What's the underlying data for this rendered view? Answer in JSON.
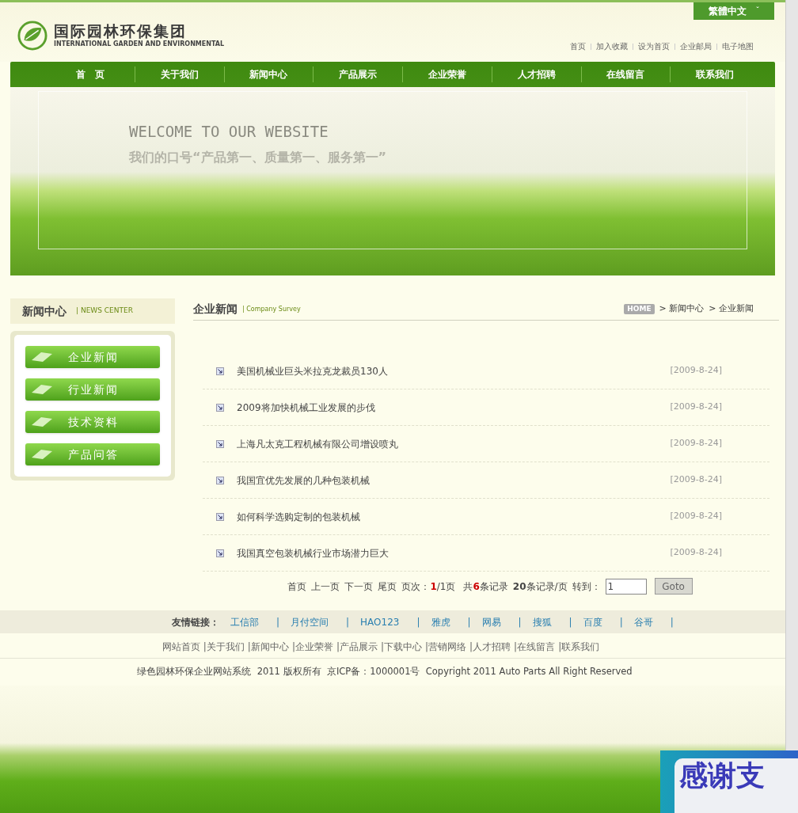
{
  "language_button": {
    "label": "繁體中文",
    "caret": "ˇ"
  },
  "logo": {
    "title": "国际园林环保集团",
    "subtitle": "INTERNATIONAL GARDEN AND ENVIRONMENTAL"
  },
  "top_links": [
    "首页",
    "加入收藏",
    "设为首页",
    "企业邮局",
    "电子地图"
  ],
  "nav": [
    {
      "label": "首　页"
    },
    {
      "label": "关于我们"
    },
    {
      "label": "新闻中心"
    },
    {
      "label": "产品展示"
    },
    {
      "label": "企业荣誉"
    },
    {
      "label": "人才招聘"
    },
    {
      "label": "在线留言"
    },
    {
      "label": "联系我们"
    }
  ],
  "banner": {
    "headline": "WELCOME TO OUR WEBSITE",
    "slogan": "我们的口号“产品第一、质量第一、服务第一”"
  },
  "sidebar": {
    "title": "新闻中心",
    "subtitle": "| NEWS CENTER",
    "items": [
      "企业新闻",
      "行业新闻",
      "技术资料",
      "产品问答"
    ]
  },
  "content": {
    "title": "企业新闻",
    "subtitle": "| Company Survey",
    "breadcrumb": {
      "home": "HOME",
      "items": [
        "> 新闻中心",
        "> 企业新闻"
      ]
    }
  },
  "news": [
    {
      "title": "美国机械业巨头米拉克龙裁员130人",
      "date": "[2009-8-24]"
    },
    {
      "title": "2009将加快机械工业发展的步伐",
      "date": "[2009-8-24]"
    },
    {
      "title": "上海凡太克工程机械有限公司增设喷丸",
      "date": "[2009-8-24]"
    },
    {
      "title": "我国宜优先发展的几种包装机械",
      "date": "[2009-8-24]"
    },
    {
      "title": "如何科学选购定制的包装机械",
      "date": "[2009-8-24]"
    },
    {
      "title": "我国真空包装机械行业市场潜力巨大",
      "date": "[2009-8-24]"
    }
  ],
  "pagination": {
    "links": [
      "首页",
      "上一页",
      "下一页",
      "尾页"
    ],
    "page_info": "页次：**1**/1页",
    "records": "共**6**条记录",
    "per_page": "**20**条记录/页",
    "goto_label": "转到：",
    "goto_value": "1",
    "goto_button": "Goto"
  },
  "friend_links": {
    "label": "友情链接：",
    "items": [
      "工信部",
      "月付空间",
      "HAO123",
      "雅虎",
      "网易",
      "搜狐",
      "百度",
      "谷哥"
    ],
    "separator": "|"
  },
  "footer_nav": [
    "网站首页",
    "|关于我们",
    "|新闻中心",
    "|企业荣誉",
    "|产品展示",
    "|下载中心",
    "|营销网络",
    "|人才招聘",
    "|在线留言",
    "|联系我们"
  ],
  "copyright": "绿色园林环保企业网站系统  2011 版权所有  京ICP备：1000001号  Copyright 2011 Auto Parts All Right Reserved",
  "popup": {
    "text": "感谢支"
  }
}
